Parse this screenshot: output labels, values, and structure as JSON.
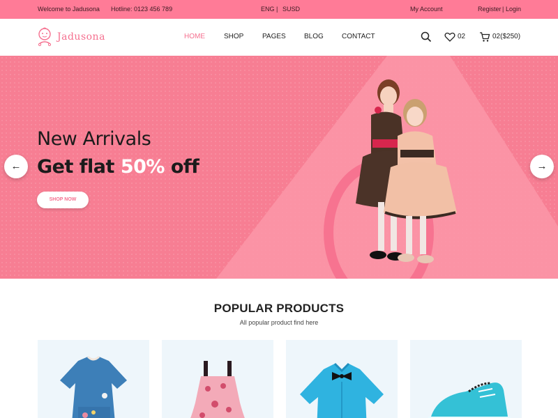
{
  "topbar": {
    "welcome": "Welcome to Jadusona",
    "hotline": "Hotline: 0123 456 789",
    "language": "ENG",
    "separator": "|",
    "currency": "SUSD",
    "account": "My Account",
    "register": "Register",
    "pipe": "|",
    "login": "Login"
  },
  "header": {
    "logo_text": "Jadusona",
    "nav": [
      "HOME",
      "SHOP",
      "PAGES",
      "BLOG",
      "CONTACT"
    ],
    "active_nav": "HOME",
    "wishlist_count": "02",
    "cart_text": "02($250)",
    "icons": [
      "search-icon",
      "heart-icon",
      "cart-icon"
    ]
  },
  "hero": {
    "title": "New Arrivals",
    "subtitle_prefix": "Get flat ",
    "subtitle_highlight": "50%",
    "subtitle_suffix": " off",
    "button": "SHOP NOW",
    "prev_arrow": "←",
    "next_arrow": "→"
  },
  "popular": {
    "title": "POPULAR PRODUCTS",
    "subtitle": "All popular product find here"
  },
  "colors": {
    "brand_pink": "#f5708f",
    "topbar_bg": "#ff7b97",
    "hero_bg": "#f77e93",
    "card_bg": "#eef6fb"
  }
}
